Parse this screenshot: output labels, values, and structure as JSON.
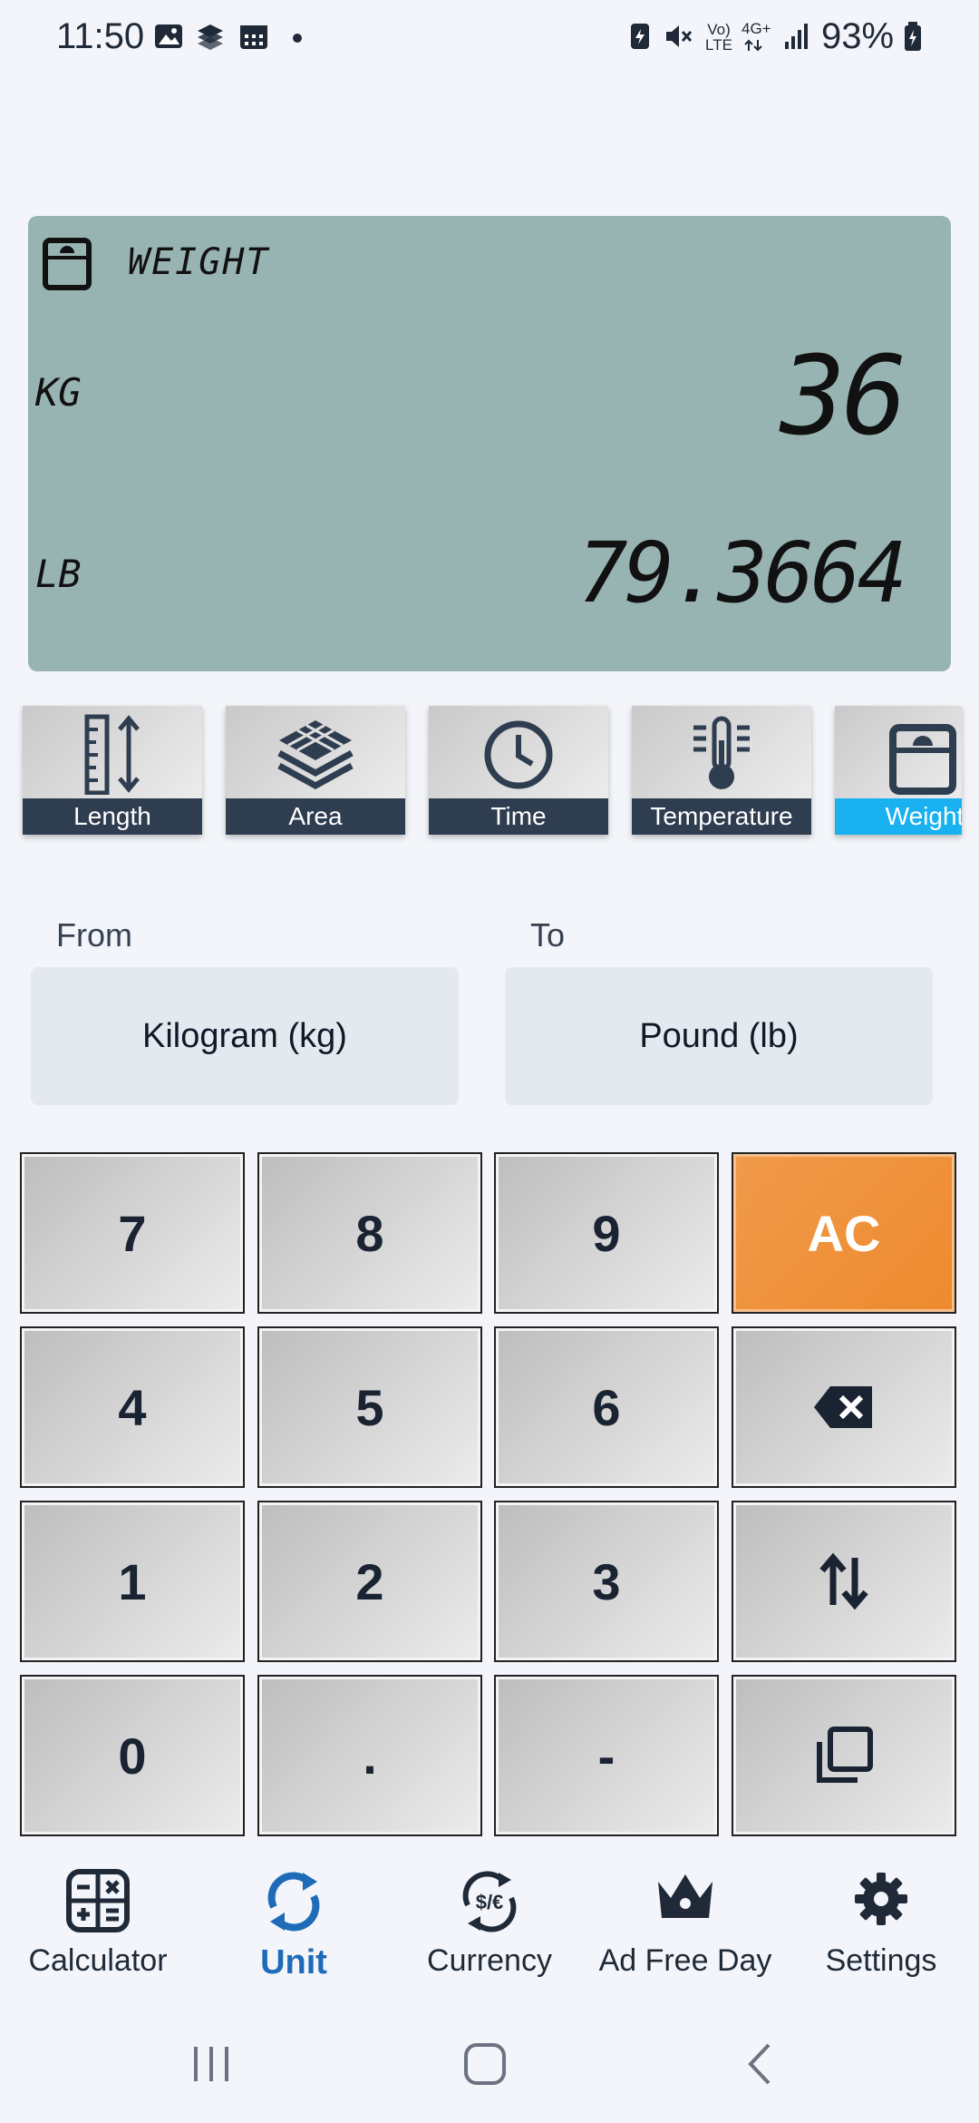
{
  "status_bar": {
    "time": "11:50",
    "battery_percent": "93%",
    "network_top": "4G+",
    "volte_top": "Vo)",
    "volte_bottom": "LTE"
  },
  "display": {
    "category": "WEIGHT",
    "from_unit_abbr": "KG",
    "from_value": "36",
    "to_unit_abbr": "LB",
    "to_value": "79.3664"
  },
  "categories": [
    {
      "label": "Length",
      "icon": "ruler-arrows-icon"
    },
    {
      "label": "Area",
      "icon": "layers-grid-icon"
    },
    {
      "label": "Time",
      "icon": "clock-icon"
    },
    {
      "label": "Temperature",
      "icon": "thermometer-icon"
    },
    {
      "label": "Weight",
      "icon": "weight-scale-icon",
      "active": true
    }
  ],
  "converter": {
    "from_label": "From",
    "from_unit": "Kilogram (kg)",
    "to_label": "To",
    "to_unit": "Pound (lb)"
  },
  "keypad": {
    "k7": "7",
    "k8": "8",
    "k9": "9",
    "ac": "AC",
    "k4": "4",
    "k5": "5",
    "k6": "6",
    "k1": "1",
    "k2": "2",
    "k3": "3",
    "k0": "0",
    "dot": ".",
    "minus": "-"
  },
  "bottom_nav": [
    {
      "label": "Calculator"
    },
    {
      "label": "Unit",
      "active": true
    },
    {
      "label": "Currency"
    },
    {
      "label": "Ad Free Day"
    },
    {
      "label": "Settings"
    }
  ],
  "colors": {
    "accent": "#1e6bb8",
    "lcd": "#97b4b3",
    "ac_key": "#ee8a2d",
    "active_tab": "#1ab1f0"
  }
}
